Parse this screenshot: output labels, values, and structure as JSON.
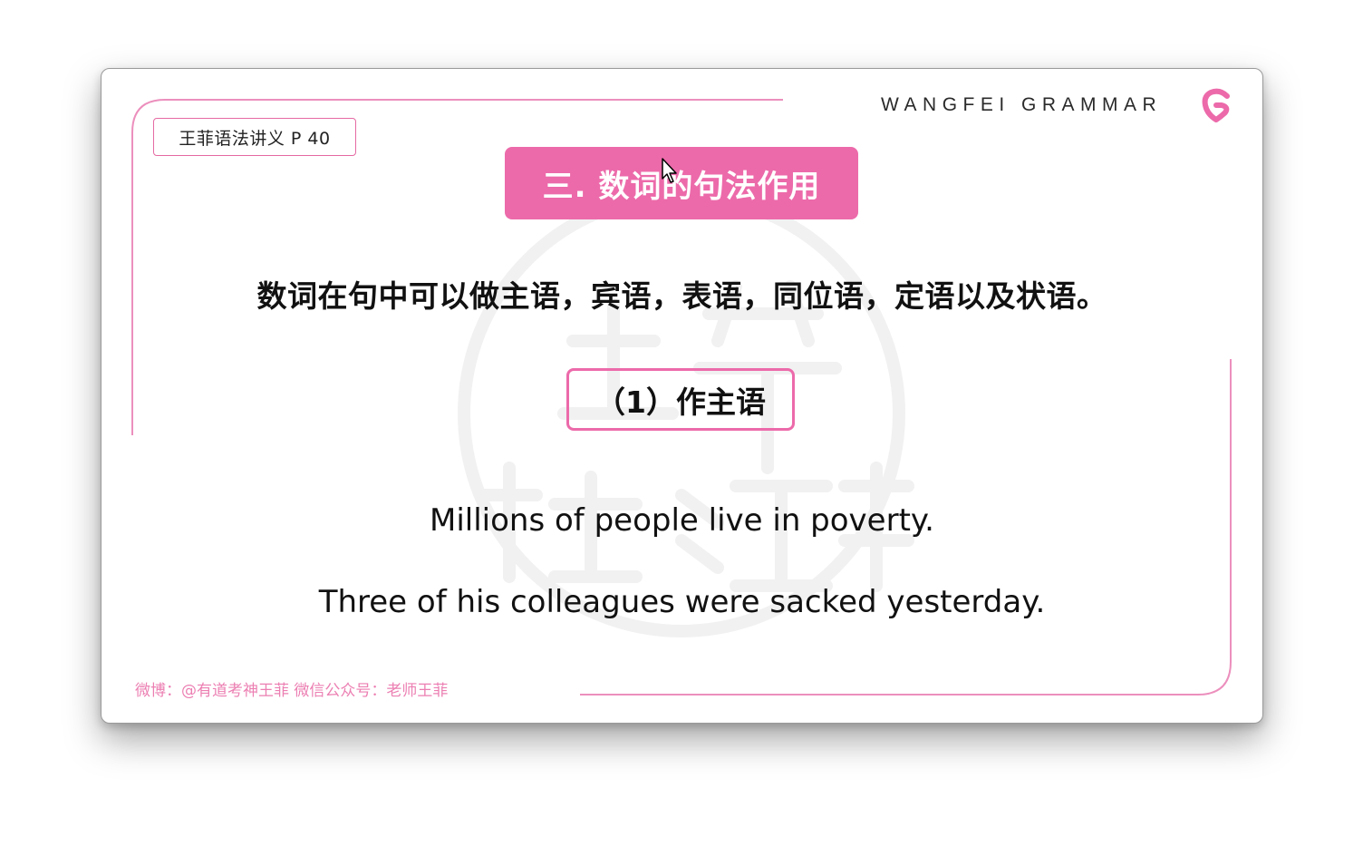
{
  "page_tag": "王菲语法讲义 P 40",
  "brand": {
    "name": "WANGFEI GRAMMAR",
    "logo_icon": "g-heart-logo",
    "accent_color": "#ec6aaa"
  },
  "slide": {
    "title": "三. 数词的句法作用",
    "intro": "数词在句中可以做主语，宾语，表语，同位语，定语以及状语。",
    "section_label": "（1）作主语",
    "examples": [
      "Millions of people live in poverty.",
      "Three of his colleagues were sacked yesterday."
    ]
  },
  "footer": "微博：@有道考神王菲 微信公众号：老师王菲"
}
